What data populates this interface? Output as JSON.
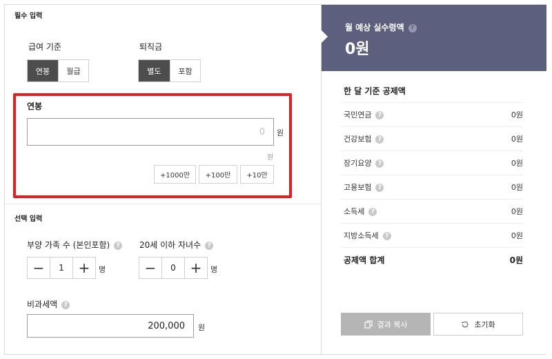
{
  "required": {
    "title": "필수 입력",
    "pay_basis": {
      "label": "급여 기준",
      "options": [
        "연봉",
        "월급"
      ],
      "selected": "연봉"
    },
    "severance": {
      "label": "퇴직금",
      "options": [
        "별도",
        "포함"
      ],
      "selected": "별도"
    },
    "salary": {
      "label": "연봉",
      "value": "0",
      "unit": "원",
      "sub_unit": "원",
      "quick_add": [
        "+1000만",
        "+100만",
        "+10만"
      ]
    }
  },
  "optional": {
    "title": "선택 입력",
    "dependents": {
      "label": "부양 가족 수 (본인포함)",
      "value": "1",
      "unit": "명",
      "help": "?"
    },
    "children": {
      "label": "20세 이하 자녀수",
      "value": "0",
      "unit": "명",
      "help": "?"
    },
    "nontaxable": {
      "label": "비과세액",
      "value": "200,000",
      "unit": "원",
      "help": "?"
    }
  },
  "result": {
    "title": "월 예상 실수령액",
    "help": "?",
    "amount": "0원",
    "deduction_title": "한 달 기준 공제액",
    "deductions": [
      {
        "name": "국민연금",
        "value": "0원"
      },
      {
        "name": "건강보험",
        "value": "0원"
      },
      {
        "name": "장기요양",
        "value": "0원"
      },
      {
        "name": "고용보험",
        "value": "0원"
      },
      {
        "name": "소득세",
        "value": "0원"
      },
      {
        "name": "지방소득세",
        "value": "0원"
      }
    ],
    "total": {
      "name": "공제액 합계",
      "value": "0원"
    },
    "copy_label": "결과 복사",
    "reset_label": "초기화"
  },
  "colors": {
    "header_bg": "#5c5f7d",
    "selected_bg": "#4d4d4d",
    "highlight": "#e02020",
    "copy_bg": "#b5b5b5"
  },
  "icons": {
    "minus": "−",
    "plus": "+",
    "help": "?",
    "copy": "copy-icon",
    "reset": "reset-icon"
  }
}
